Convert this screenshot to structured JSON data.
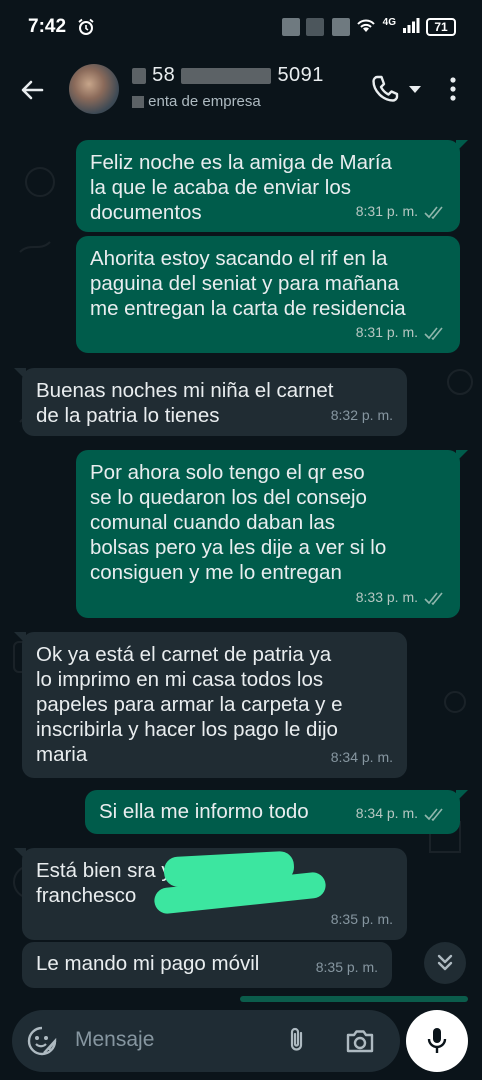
{
  "status": {
    "time": "7:42",
    "network": "4G",
    "battery": "71"
  },
  "header": {
    "contact_prefix": "58",
    "contact_suffix": "5091",
    "subtitle": "enta de empresa"
  },
  "messages": [
    {
      "dir": "out",
      "text": "Feliz noche es la amiga de María\nla que le acaba de enviar los\ndocumentos",
      "time": "8:31 p. m."
    },
    {
      "dir": "out",
      "text": "Ahorita estoy sacando el rif en la\npaguina del seniat y para mañana\nme entregan la carta de residencia",
      "time": "8:31 p. m."
    },
    {
      "dir": "in",
      "text": "Buenas noches mi niña el carnet\nde la patria lo tienes",
      "time": "8:32 p. m."
    },
    {
      "dir": "out",
      "text": "Por ahora solo tengo el qr eso\nse lo quedaron los del consejo\ncomunal cuando daban las\nbolsas pero ya les dije a ver si lo\nconsiguen y me lo entregan",
      "time": "8:33 p. m."
    },
    {
      "dir": "in",
      "text": "Ok ya está el carnet de patria ya\nlo imprimo en mi casa todos los\npapeles para armar la carpeta y e\ninscribirla y hacer los pago le dijo\nmaria",
      "time": "8:34 p. m."
    },
    {
      "dir": "out",
      "text": "Si ella me informo todo",
      "time": "8:34 p. m."
    },
    {
      "dir": "in",
      "text": "Está bien sra                        yo soy\nfranchesco",
      "time": "8:35 p. m."
    },
    {
      "dir": "in",
      "text": "Le mando mi pago móvil",
      "time": "8:35 p. m."
    }
  ],
  "input": {
    "placeholder": "Mensaje"
  },
  "colors": {
    "outgoing": "#005c4b",
    "incoming": "#202c33",
    "background": "#0b141a",
    "redaction": "#3ce6a0"
  },
  "icons": [
    "alarm-icon",
    "back-arrow-icon",
    "phone-icon",
    "dropdown-icon",
    "more-vert-icon",
    "double-check-icon",
    "chevrons-down-icon",
    "emoji-icon",
    "attach-icon",
    "camera-icon",
    "mic-icon"
  ]
}
